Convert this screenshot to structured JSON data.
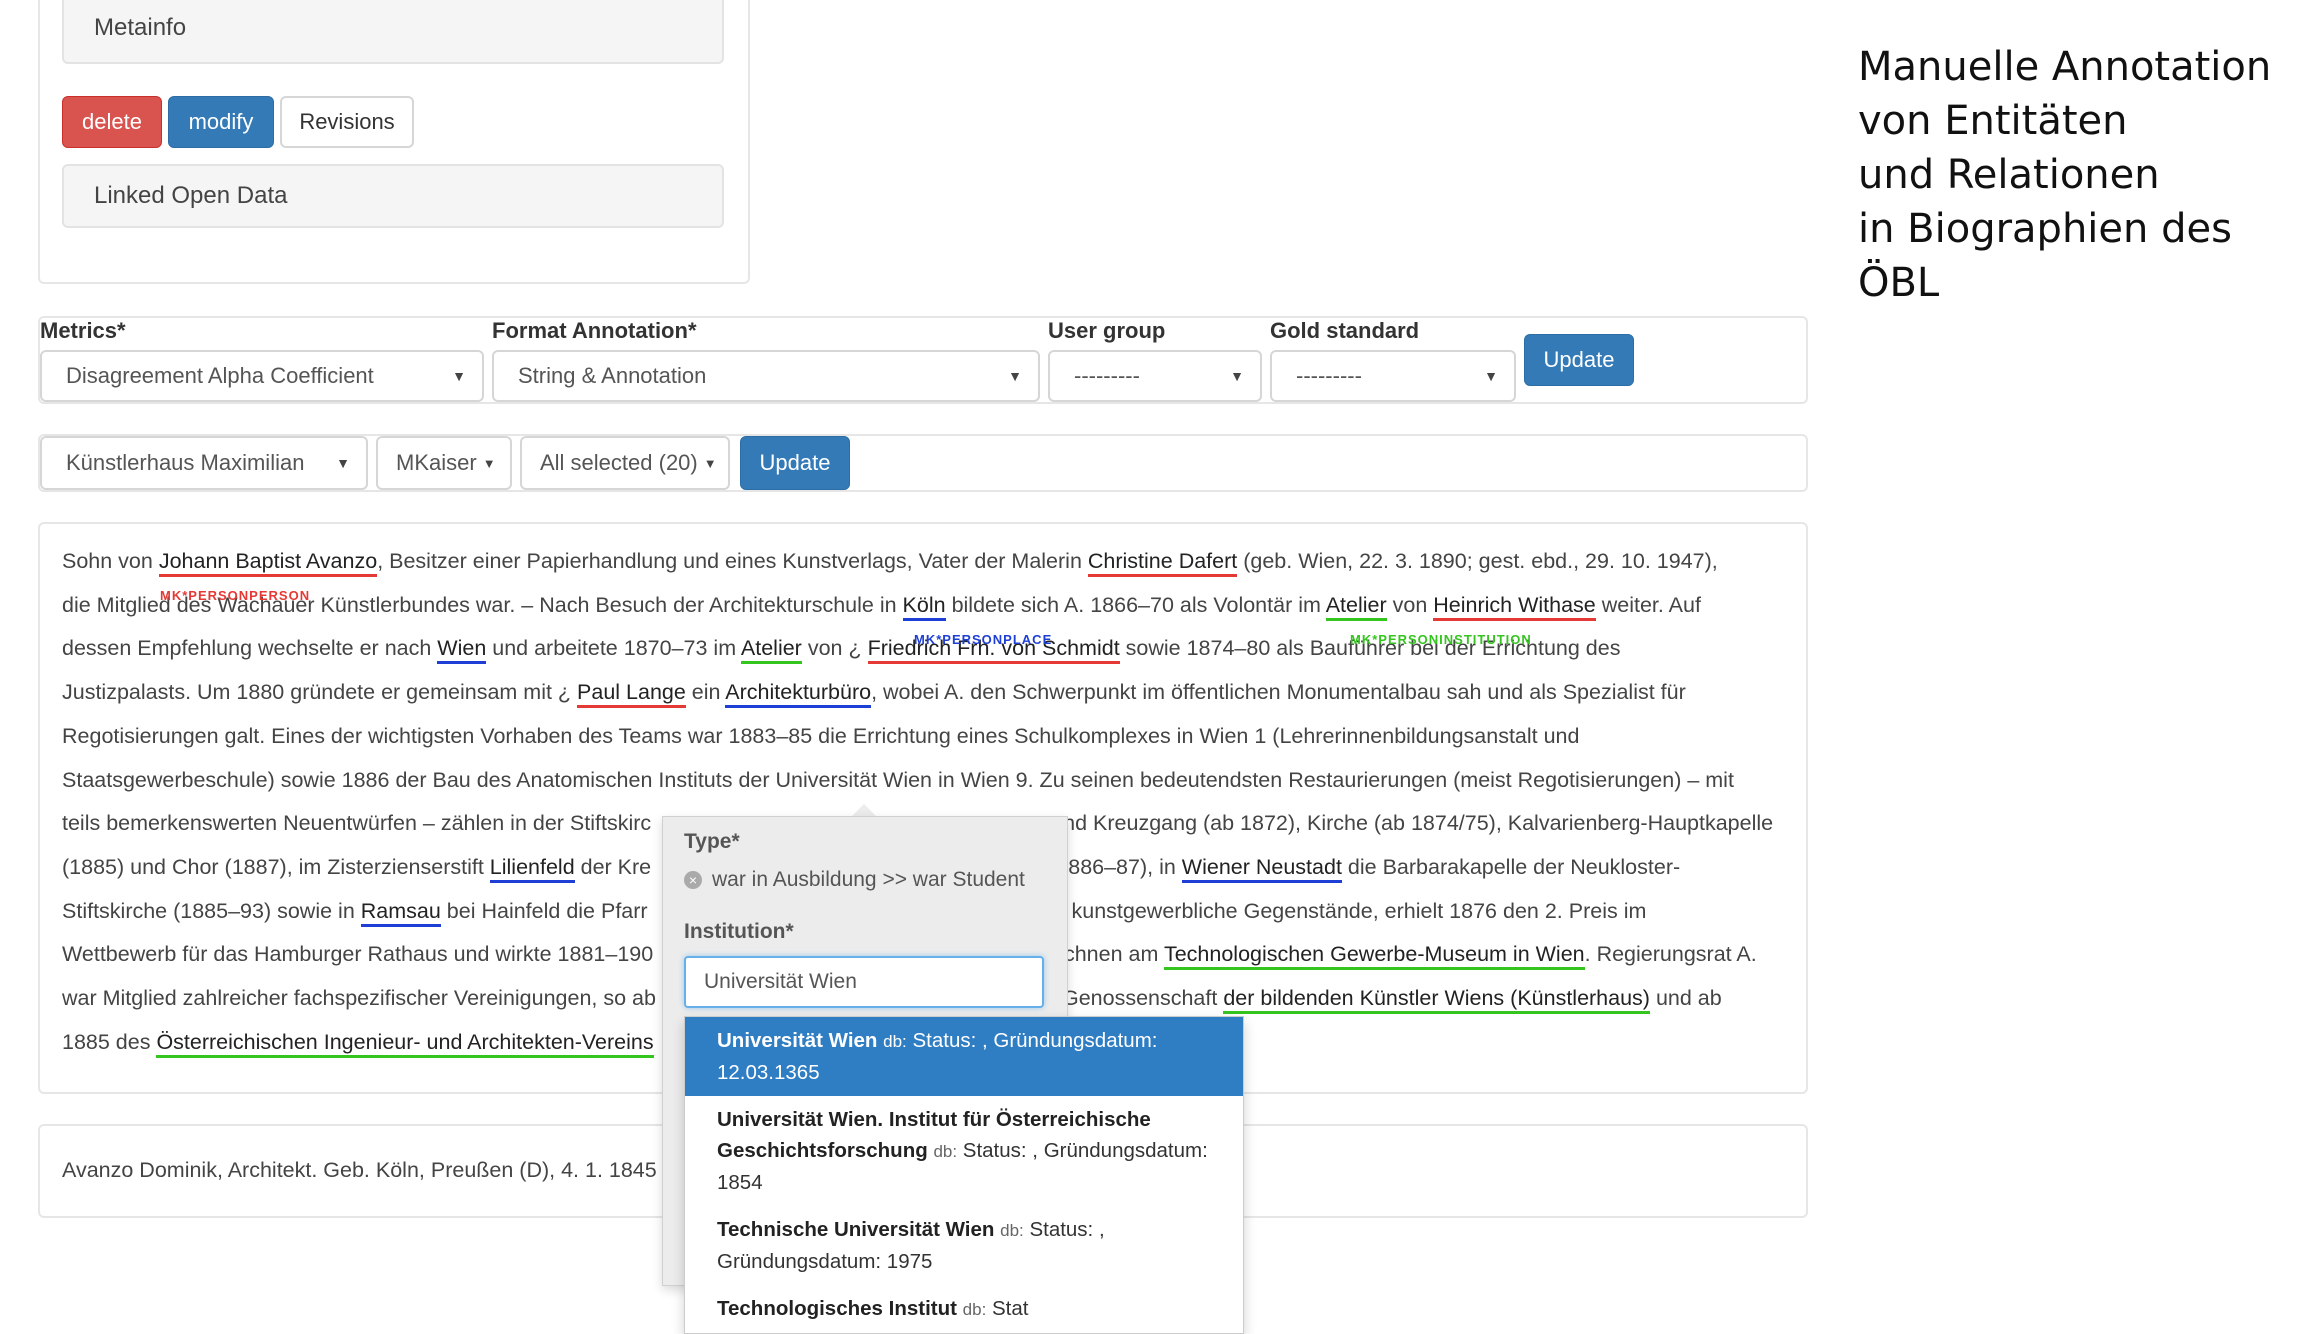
{
  "top_panel": {
    "metainfo_label": "Metainfo",
    "delete_label": "delete",
    "modify_label": "modify",
    "revisions_label": "Revisions",
    "lod_label": "Linked Open Data"
  },
  "filters": {
    "metrics_label": "Metrics*",
    "metrics_value": "Disagreement Alpha Coefficient",
    "format_label": "Format Annotation*",
    "format_value": "String & Annotation",
    "usergroup_label": "User group",
    "usergroup_value": "---------",
    "gold_label": "Gold standard",
    "gold_value": "---------",
    "update_label": "Update"
  },
  "toolbar": {
    "project_value": "Künstlerhaus Maximilian",
    "user_value": "MKaiser",
    "selection_value": "All selected (20)",
    "update_label": "Update"
  },
  "bio": {
    "t1": "Sohn von ",
    "e1": "Johann Baptist Avanzo",
    "t2": ", Besitzer einer Papierhandlung und eines Kunstverlags, Vater der Malerin ",
    "e2": "Christine Dafert",
    "t3": " (geb. Wien, 22. 3. 1890; gest. ebd., 29. 10. 1947),",
    "t4": "die Mitglied des Wachauer Künstlerbundes war. – Nach Besuch der Architekturschule in ",
    "e3": "Köln",
    "t5": " bildete sich A. 1866–70 als Volontär im ",
    "e4": "Atelier",
    "t6": " von ",
    "e5": "Heinrich Withase",
    "t7": " weiter. Auf",
    "t8": "dessen Empfehlung wechselte er nach ",
    "e6": "Wien",
    "t9": " und arbeitete 1870–73 im ",
    "e7": "Atelier",
    "t10": " von ¿ ",
    "e8": "Friedrich Frh. von Schmidt",
    "t11": " sowie 1874–80 als Bauführer bei der Errichtung des",
    "t12": "Justizpalasts. Um 1880 gründete er gemeinsam mit ¿ ",
    "e9": "Paul Lange",
    "t13": " ein ",
    "e10": "Architekturbüro",
    "t14": ", wobei A. den Schwerpunkt im öffentlichen Monumentalbau sah und als Spezialist für",
    "t15": "Regotisierungen galt. Eines der wichtigsten Vorhaben des Teams war 1883–85 die Errichtung eines Schulkomplexes in Wien 1 (Lehrerinnenbildungsanstalt und",
    "t16": "Staatsgewerbeschule) sowie 1886 der Bau des Anatomischen Instituts der Universität Wien in Wien 9. Zu seinen bedeutendsten Restaurierungen (meist Regotisierungen) – mit",
    "t17a": "teils bemerkenswerten Neuentwürfen – zählen in der Stiftskirc",
    "t17b": "nd Kreuzgang (ab 1872), Kirche (ab 1874/75), Kalvarienberg-Hauptkapelle",
    "t18a": "(1885) und Chor (1887), im Zisterzienserstift ",
    "e11": "Lilienfeld",
    "t18b": " der Kre",
    "t18c": " (1886–87), in ",
    "e12": "Wiener Neustadt",
    "t18d": " die Barbarakapelle der Neukloster-",
    "t19a": "Stiftskirche (1885–93) sowie in ",
    "e13": "Ramsau",
    "t19b": " bei Hainfeld die Pfarr",
    "t19c": "h kunstgewerbliche Gegenstände, erhielt 1876 den 2. Preis im",
    "t20a": "Wettbewerb für das Hamburger Rathaus und wirkte 1881–190",
    "t20b": "ichnen am ",
    "e14": "Technologischen Gewerbe-Museum in Wien",
    "t20c": ". Regierungsrat A.",
    "t21a": "war Mitglied zahlreicher fachspezifischer Vereinigungen, so ab",
    "t21b": "Genossenschaft ",
    "e15": "der bildenden Künstler Wiens (Künstlerhaus)",
    "t21c": " und ab",
    "t22": "1885 des ",
    "e16": "Österreichischen Ingenieur- und Architekten-Vereins"
  },
  "tags": {
    "personperson": "MK*PERSONPERSON",
    "personplace": "MK*PERSONPLACE",
    "personinstitution": "MK*PERSONINSTITUTION"
  },
  "footer": {
    "text": "Avanzo Dominik, Architekt. Geb. Köln, Preußen (D), 4. 1. 1845"
  },
  "popover": {
    "type_label": "Type*",
    "type_value": "war in Ausbildung >> war Student",
    "institution_label": "Institution*",
    "institution_input": "Universität Wien"
  },
  "suggestions": [
    {
      "name": "Universität Wien",
      "db": "db:",
      "rest": " Status: , Gründungsdatum: 12.03.1365"
    },
    {
      "name": "Universität Wien. Institut für Österreichische Geschichtsforschung",
      "db": "db:",
      "rest": " Status: , Gründungsdatum: 1854"
    },
    {
      "name": "Technische Universität Wien",
      "db": "db:",
      "rest": " Status: , Gründungsdatum: 1975"
    },
    {
      "name": "Technologisches Institut",
      "db": "db:",
      "rest": " Stat"
    }
  ],
  "side_title": {
    "line1": "Manuelle Annotation",
    "line2": "von Entitäten",
    "line3": "und Relationen",
    "line4": "in Biographien des ÖBL"
  },
  "colors": {
    "red": "#e53935",
    "blue": "#1e3fd6",
    "green": "#34c51f",
    "primary": "#337ab7",
    "danger": "#d9534f"
  }
}
